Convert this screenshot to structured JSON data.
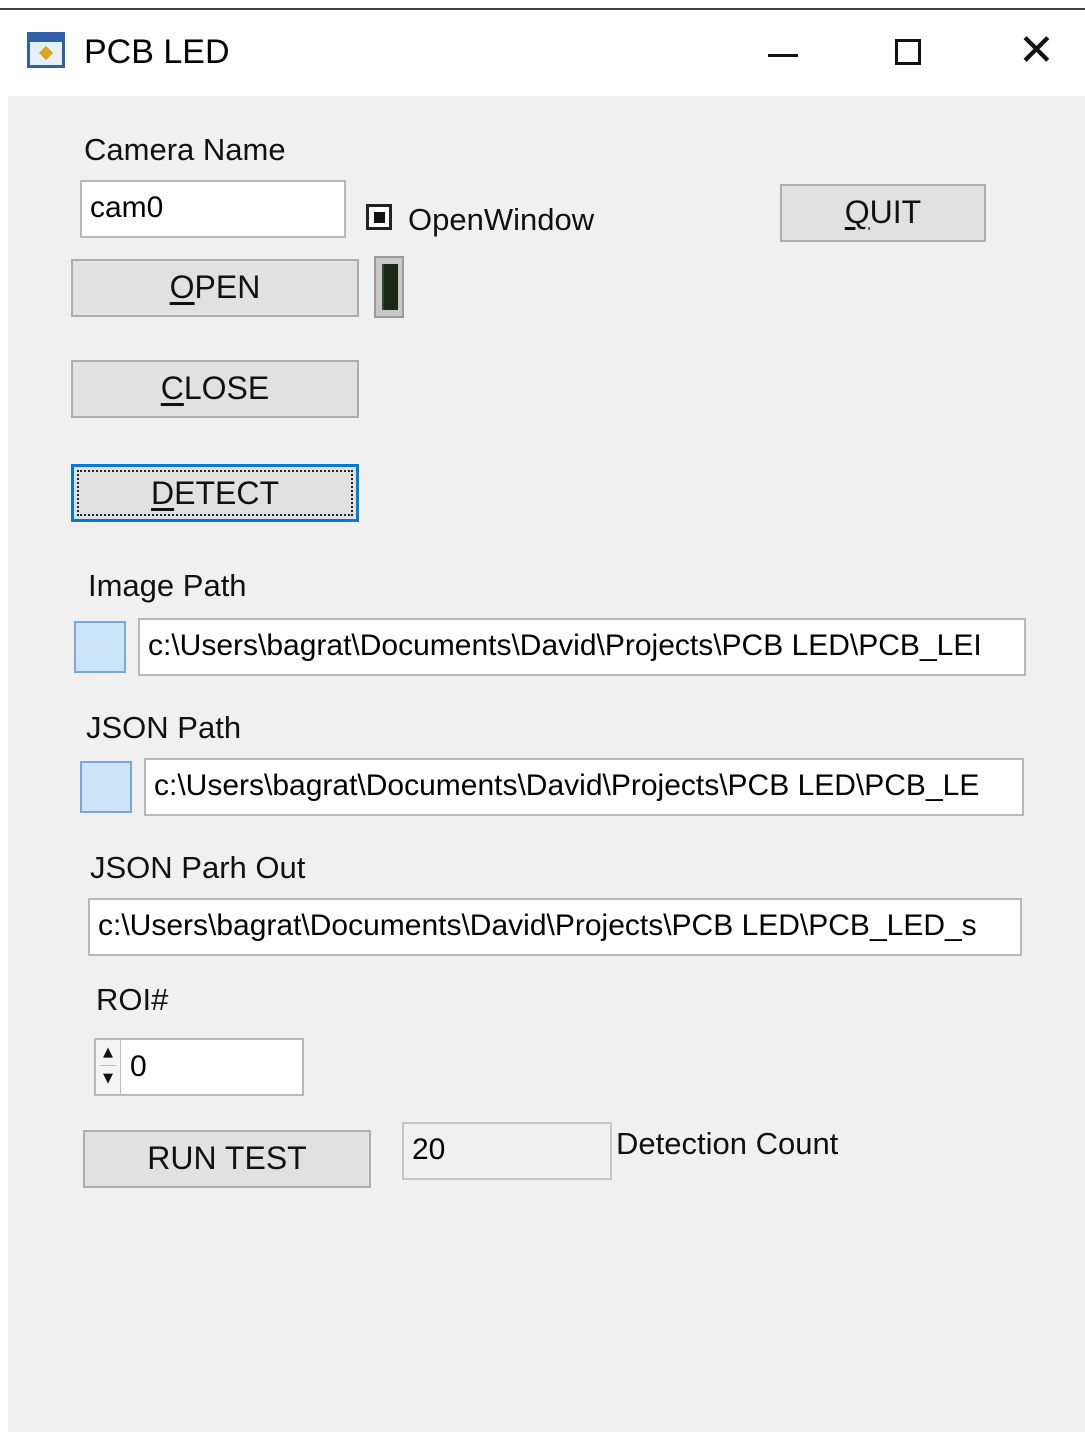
{
  "window": {
    "title": "PCB LED",
    "icons": {
      "app": "app-icon",
      "minimize": "minimize-icon",
      "maximize": "maximize-icon",
      "close": "close-icon"
    },
    "accent": "#0078d7"
  },
  "camera": {
    "label": "Camera Name",
    "value": "cam0",
    "open_window_label": "OpenWindow",
    "open_window_checked": true
  },
  "buttons": {
    "quit": {
      "label": "QUIT",
      "mnemonic": "Q",
      "rest": "UIT"
    },
    "open": {
      "label": "OPEN",
      "mnemonic": "O",
      "rest": "PEN"
    },
    "close": {
      "label": "CLOSE",
      "mnemonic": "C",
      "rest": "LOSE"
    },
    "detect": {
      "label": "DETECT",
      "mnemonic": "D",
      "rest": "ETECT"
    },
    "run_test": {
      "label": "RUN TEST"
    }
  },
  "image_path": {
    "label": "Image Path",
    "value": "c:\\Users\\bagrat\\Documents\\David\\Projects\\PCB LED\\PCB_LEI"
  },
  "json_path": {
    "label": "JSON Path",
    "value": "c:\\Users\\bagrat\\Documents\\David\\Projects\\PCB LED\\PCB_LE"
  },
  "json_path_out": {
    "label": "JSON Parh Out",
    "value": "c:\\Users\\bagrat\\Documents\\David\\Projects\\PCB LED\\PCB_LED_s"
  },
  "roi": {
    "label": "ROI#",
    "value": "0"
  },
  "detection": {
    "value": "20",
    "label": "Detection Count"
  }
}
